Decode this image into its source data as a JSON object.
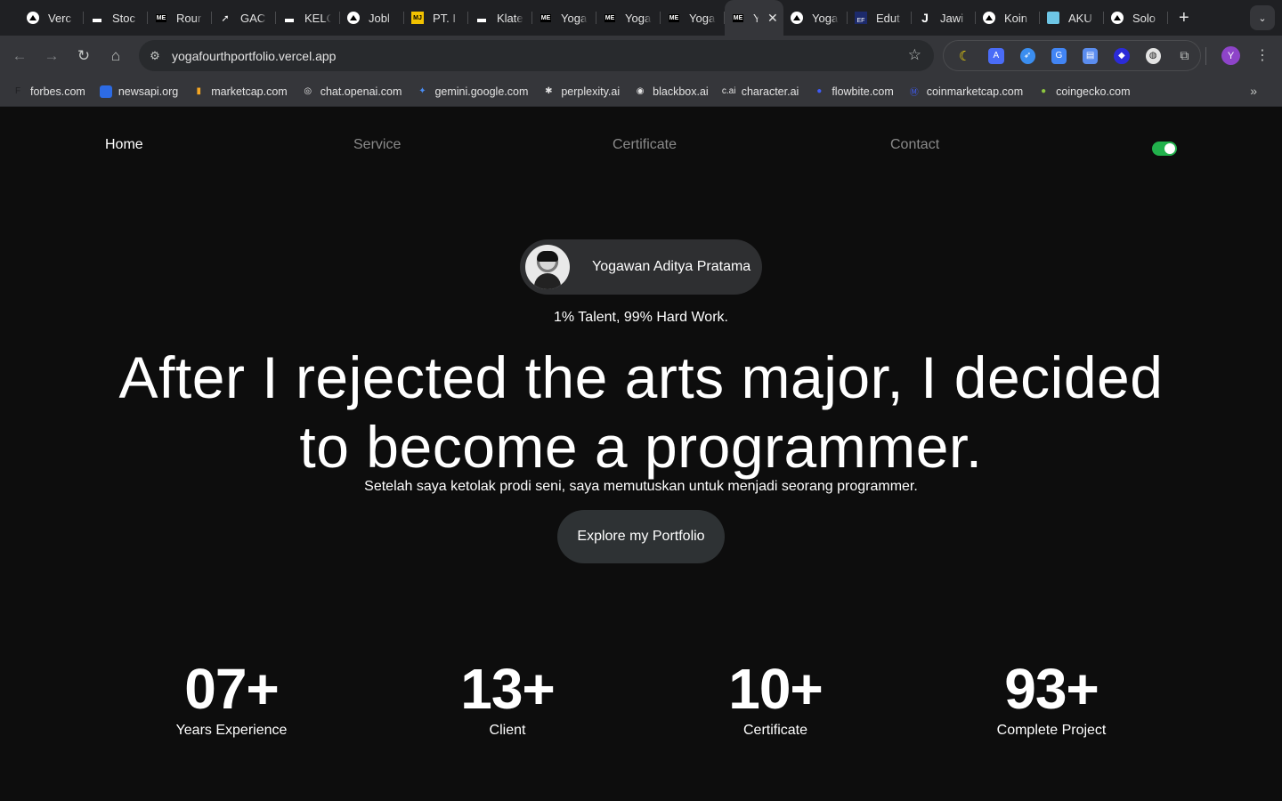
{
  "browser": {
    "tabs": [
      {
        "title": "Verc",
        "icon": "triangle-icon"
      },
      {
        "title": "Stoc",
        "icon": "bar-icon"
      },
      {
        "title": "Rour",
        "icon": "me-icon"
      },
      {
        "title": "GAC",
        "icon": "arrow-icon"
      },
      {
        "title": "KELC",
        "icon": "bar-icon"
      },
      {
        "title": "Jobl",
        "icon": "triangle-icon"
      },
      {
        "title": "PT. I",
        "icon": "mj-icon"
      },
      {
        "title": "Klate",
        "icon": "bar-icon"
      },
      {
        "title": "Yoga",
        "icon": "me-icon"
      },
      {
        "title": "Yoga",
        "icon": "me-icon"
      },
      {
        "title": "Yoga",
        "icon": "me-icon"
      },
      {
        "title": "Y",
        "icon": "me-icon",
        "active": true
      },
      {
        "title": "Yoga",
        "icon": "triangle-icon"
      },
      {
        "title": "Edut",
        "icon": "ef-icon"
      },
      {
        "title": "Jawi",
        "icon": "j-icon"
      },
      {
        "title": "Koin",
        "icon": "triangle-icon"
      },
      {
        "title": "AKU",
        "icon": "image-icon"
      },
      {
        "title": "Solo",
        "icon": "triangle-icon"
      }
    ],
    "url": "yogafourthportfolio.vercel.app",
    "profile_initial": "Y",
    "bookmarks": [
      {
        "label": "forbes.com",
        "icon": "F",
        "color": "#1f2023"
      },
      {
        "label": "newsapi.org",
        "icon": "",
        "color": "#2d6be4"
      },
      {
        "label": "marketcap.com",
        "icon": "▮",
        "color": "#f5a623"
      },
      {
        "label": "chat.openai.com",
        "icon": "◎",
        "color": "#e3e3e3"
      },
      {
        "label": "gemini.google.com",
        "icon": "✦",
        "color": "#4a8df5"
      },
      {
        "label": "perplexity.ai",
        "icon": "✱",
        "color": "#e3e3e3"
      },
      {
        "label": "blackbox.ai",
        "icon": "◉",
        "color": "#e3e3e3"
      },
      {
        "label": "character.ai",
        "icon": "c.ai",
        "color": "#e3e3e3"
      },
      {
        "label": "flowbite.com",
        "icon": "●",
        "color": "#3f5bf6"
      },
      {
        "label": "coinmarketcap.com",
        "icon": "Ⓜ",
        "color": "#3f5bf6"
      },
      {
        "label": "coingecko.com",
        "icon": "●",
        "color": "#8dc63f"
      }
    ]
  },
  "nav": {
    "home": "Home",
    "service": "Service",
    "certificate": "Certificate",
    "contact": "Contact",
    "theme_toggle_on": true
  },
  "hero": {
    "name": "Yogawan Aditya Pratama",
    "tagline": "1% Talent, 99% Hard Work.",
    "headline": "After I rejected the arts major, I decided to become a programmer.",
    "subline": "Setelah saya ketolak prodi seni, saya memutuskan untuk menjadi seorang programmer.",
    "cta": "Explore my Portfolio"
  },
  "stats": [
    {
      "value": "07+",
      "label": "Years Experience"
    },
    {
      "value": "13+",
      "label": "Client"
    },
    {
      "value": "10+",
      "label": "Certificate"
    },
    {
      "value": "93+",
      "label": "Complete Project"
    }
  ],
  "colors": {
    "page_bg": "#0d0d0d",
    "toggle_on": "#22b14c",
    "pill_bg": "#2e2f31",
    "nav_inactive": "#8a8a8a"
  }
}
